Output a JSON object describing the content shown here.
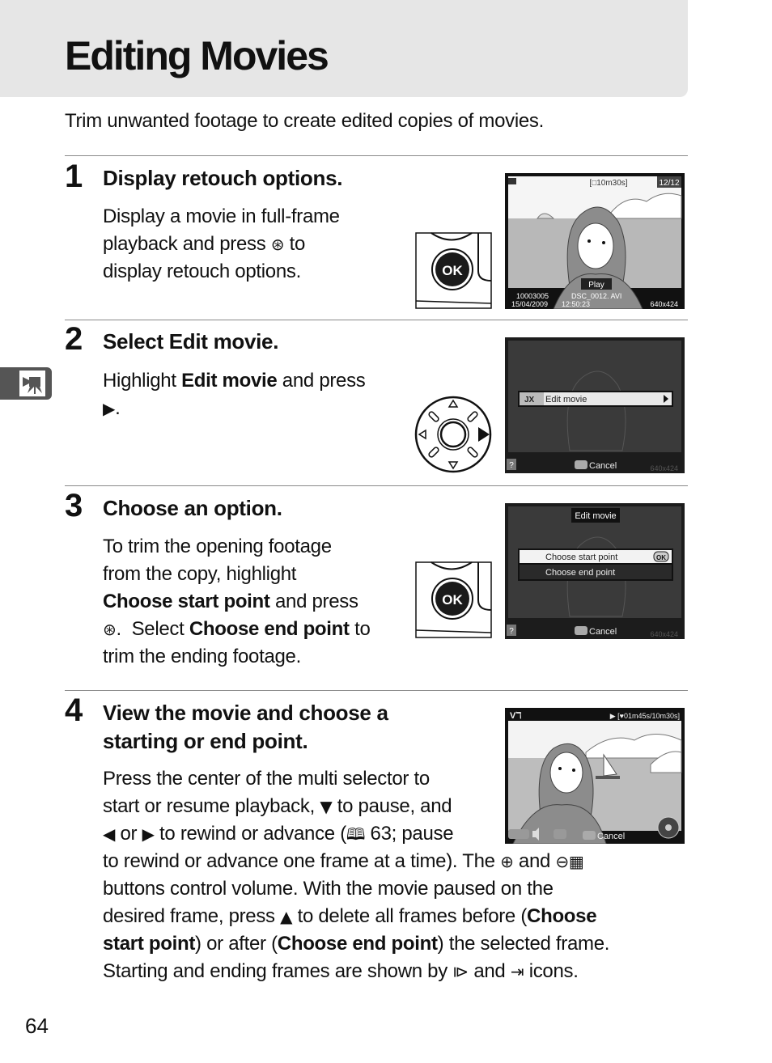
{
  "page": {
    "title": "Editing Movies",
    "intro": "Trim unwanted footage to create edited copies of movies.",
    "page_number": "64",
    "side_tab_icon": "movie-camera-icon"
  },
  "steps": [
    {
      "number": "1",
      "title": "Display retouch options.",
      "body_lines": [
        "Display a movie in full-frame",
        "playback and press",
        "to",
        "display retouch options."
      ],
      "control": "ok-button",
      "control_label": "OK",
      "screen": {
        "top_center": "[□10m30s]",
        "top_right": "12/12",
        "play_label": "Play",
        "folder": "10003005",
        "filename": "DSC_0012. AVI",
        "date": "15/04/2009",
        "time": "12:50:23",
        "size": "640x424"
      }
    },
    {
      "number": "2",
      "title_prefix": "Select ",
      "title_bold": "Edit movie",
      "title_suffix": ".",
      "body_pre": "Highlight ",
      "body_bold": "Edit movie",
      "body_post": " and press",
      "body_line2": ".",
      "control": "multi-selector",
      "screen": {
        "menu_item": "Edit movie",
        "cancel_label": "Cancel",
        "help": "?",
        "size": "640x424"
      }
    },
    {
      "number": "3",
      "title": "Choose an option.",
      "body": {
        "l1": "To trim the opening footage",
        "l2": "from the copy, highlight",
        "l3_bold": "Choose start point",
        "l3_post": " and press",
        "l4_post": ".  Select ",
        "l4_bold": "Choose end point",
        "l4_end": " to",
        "l5": "trim the ending footage."
      },
      "control": "ok-button",
      "control_label": "OK",
      "screen": {
        "header": "Edit movie",
        "options": [
          "Choose start point",
          "Choose end point"
        ],
        "selected": "Choose start point",
        "ok_badge": "OK",
        "cancel_label": "Cancel",
        "help": "?",
        "size": "640x424"
      }
    },
    {
      "number": "4",
      "title_lines": [
        "View the movie and choose a",
        "starting or end point."
      ],
      "body": {
        "l1": "Press the center of the multi selector to",
        "l2_pre": "start or resume playback, ",
        "l2_post": " to pause, and",
        "l3_mid": " or ",
        "l3_post": " to rewind or advance (",
        "l3_ref": " 63; pause",
        "l4_pre": "to rewind or advance one frame at a time). The ",
        "l4_mid": " and ",
        "l5": "buttons control volume.  With the movie paused on the",
        "l6_pre": "desired frame, press ",
        "l6_post": " to delete all frames before (",
        "l6_bold": "Choose",
        "l7_bold": "start point",
        "l7_mid": ") or after (",
        "l7_bold2": "Choose end point",
        "l7_end": ") the selected frame.",
        "l8_pre": "Starting and ending frames are shown by ",
        "l8_mid": " and ",
        "l8_end": " icons."
      },
      "screen": {
        "top_left": "Vℸ",
        "top_right": "▶ [♥01m45s/10m30s]",
        "cancel_label": "Cancel"
      }
    }
  ],
  "glyphs": {
    "ok": "⊛",
    "down": "▼",
    "up": "▲",
    "left": "◀",
    "right": "▶",
    "book": "🕮",
    "zoom_in": "⊕",
    "zoom_out": "⊖",
    "start_frame": "⧐",
    "end_frame": "⇥"
  }
}
